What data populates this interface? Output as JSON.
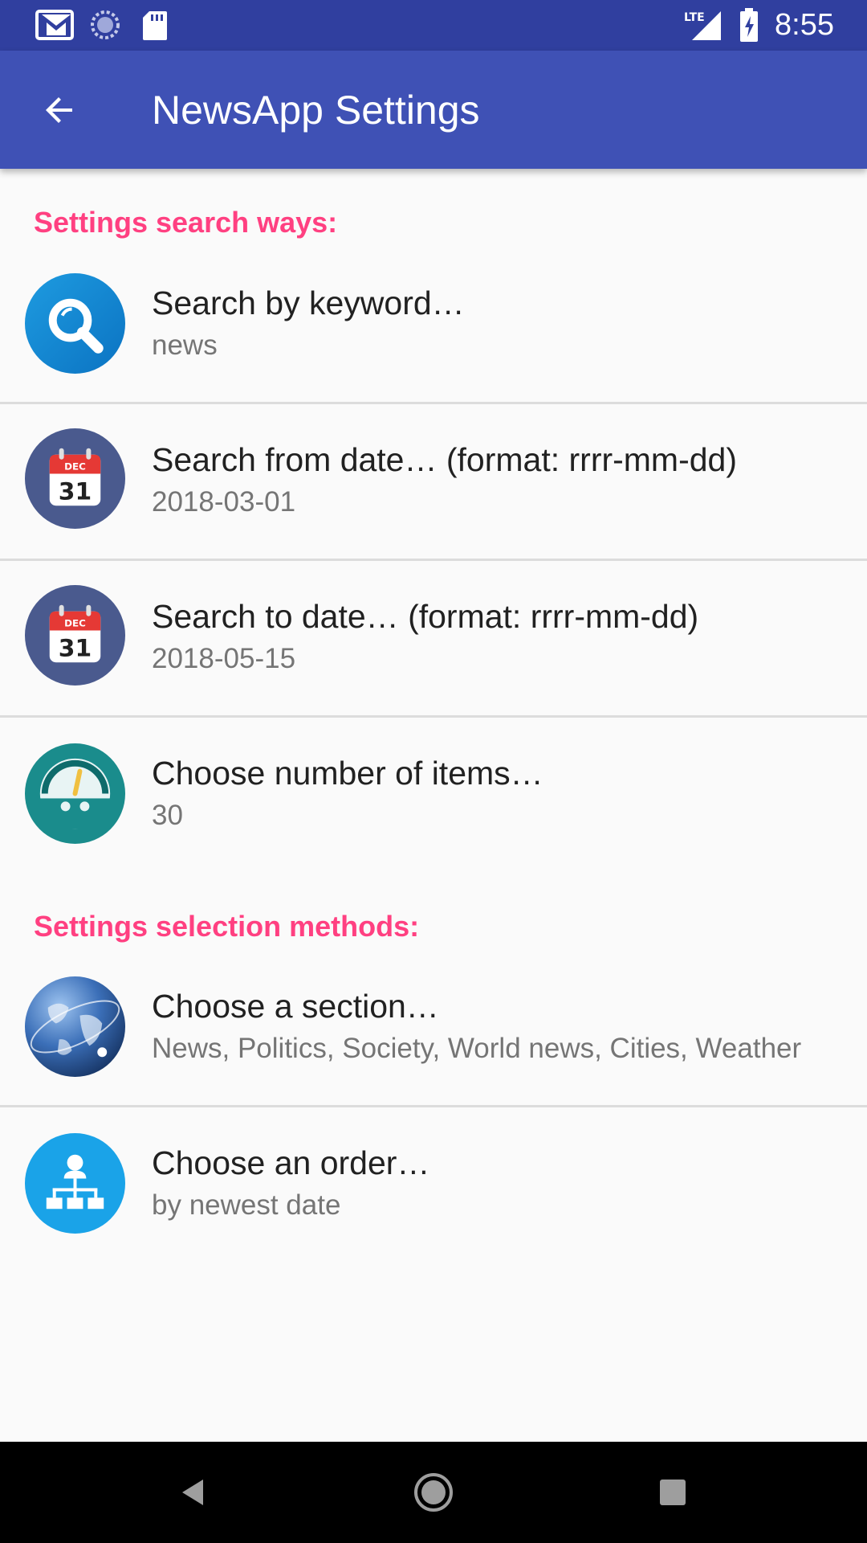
{
  "status_bar": {
    "time": "8:55",
    "icons": [
      "gmail-icon",
      "sync-icon",
      "sd-card-icon",
      "lte-signal-icon",
      "battery-charging-icon"
    ],
    "network_label": "LTE"
  },
  "app_bar": {
    "title": "NewsApp Settings",
    "back_icon": "arrow-back-icon"
  },
  "colors": {
    "status_bar": "#303f9f",
    "app_bar": "#3f51b5",
    "accent": "#ff4081",
    "background": "#fafafa",
    "divider": "#dcdcdc"
  },
  "search_section": {
    "header": "Settings search ways:",
    "items": [
      {
        "title": "Search by keyword…",
        "summary": "news",
        "icon": "search-icon"
      },
      {
        "title": "Search from date… (format: rrrr-mm-dd)",
        "summary": "2018-03-01",
        "icon": "calendar-icon",
        "icon_month": "DEC",
        "icon_day": "31"
      },
      {
        "title": "Search to date… (format: rrrr-mm-dd)",
        "summary": "2018-05-15",
        "icon": "calendar-icon",
        "icon_month": "DEC",
        "icon_day": "31"
      },
      {
        "title": "Choose number of items…",
        "summary": "30",
        "icon": "gauge-icon"
      }
    ]
  },
  "selection_section": {
    "header": "Settings selection methods:",
    "items": [
      {
        "title": "Choose a section…",
        "summary": "News, Politics, Society, World news, Cities, Weather",
        "icon": "globe-icon"
      },
      {
        "title": "Choose an order…",
        "summary": "by newest date",
        "icon": "hierarchy-icon"
      }
    ]
  },
  "nav_bar": {
    "buttons": [
      "back-triangle-icon",
      "home-circle-icon",
      "recents-square-icon"
    ]
  }
}
